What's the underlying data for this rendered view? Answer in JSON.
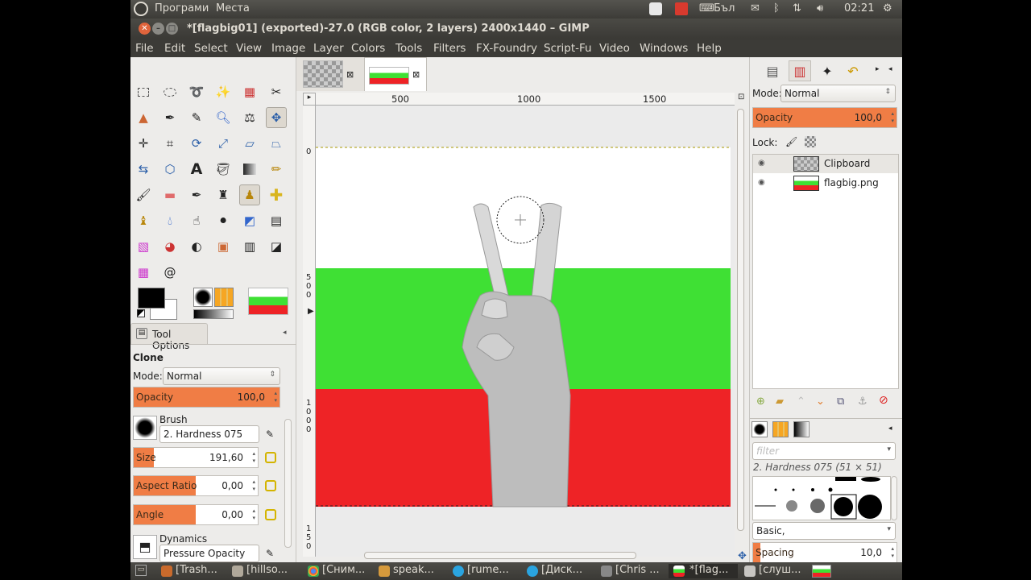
{
  "system_panel": {
    "menus": [
      "Програми",
      "Места"
    ],
    "keyboard_layout": "Бъл",
    "clock": "02:21"
  },
  "window": {
    "title": "*[flagbig01] (exported)-27.0 (RGB color, 2 layers) 2400x1440 – GIMP",
    "menu": [
      "File",
      "Edit",
      "Select",
      "View",
      "Image",
      "Layer",
      "Colors",
      "Tools",
      "Filters",
      "FX-Foundry",
      "Script-Fu",
      "Video",
      "Windows",
      "Help"
    ]
  },
  "tool_options": {
    "tab_label": "Tool Options",
    "tool_name": "Clone",
    "mode_label": "Mode:",
    "mode_value": "Normal",
    "opacity_label": "Opacity",
    "opacity_value": "100,0",
    "opacity_fraction": 1.0,
    "brush_label": "Brush",
    "brush_value": "2. Hardness 075",
    "size_label": "Size",
    "size_value": "191,60",
    "size_fraction": 0.16,
    "aspect_label": "Aspect Ratio",
    "aspect_value": "0,00",
    "aspect_fraction": 0.5,
    "angle_label": "Angle",
    "angle_value": "0,00",
    "angle_fraction": 0.5,
    "dynamics_label": "Dynamics",
    "dynamics_value": "Pressure Opacity"
  },
  "rulers": {
    "top": [
      "500",
      "1000",
      "1500"
    ],
    "left": [
      "0",
      "5 0 0",
      "1 0 0 0",
      "1 5 0"
    ]
  },
  "layers_panel": {
    "mode_label": "Mode:",
    "mode_value": "Normal",
    "opacity_label": "Opacity",
    "opacity_value": "100,0",
    "lock_label": "Lock:",
    "layers": [
      {
        "name": "Clipboard"
      },
      {
        "name": "flagbig.png"
      }
    ]
  },
  "brushes_panel": {
    "filter_placeholder": "filter",
    "brush_info": "2. Hardness 075 (51 × 51)",
    "preset": "Basic,",
    "spacing_label": "Spacing",
    "spacing_value": "10,0",
    "spacing_fraction": 0.05
  },
  "taskbar": {
    "items": [
      "[Trash...",
      "[hillso...",
      "[Сним...",
      "speak...",
      "[rume...",
      "[Диск...",
      "[Chris ...",
      "*[flag...",
      "[слуш..."
    ]
  },
  "colors": {
    "flag_white": "#ffffff",
    "flag_green": "#3fe034",
    "flag_red": "#ee2326",
    "accent_orange": "#f07d45"
  }
}
